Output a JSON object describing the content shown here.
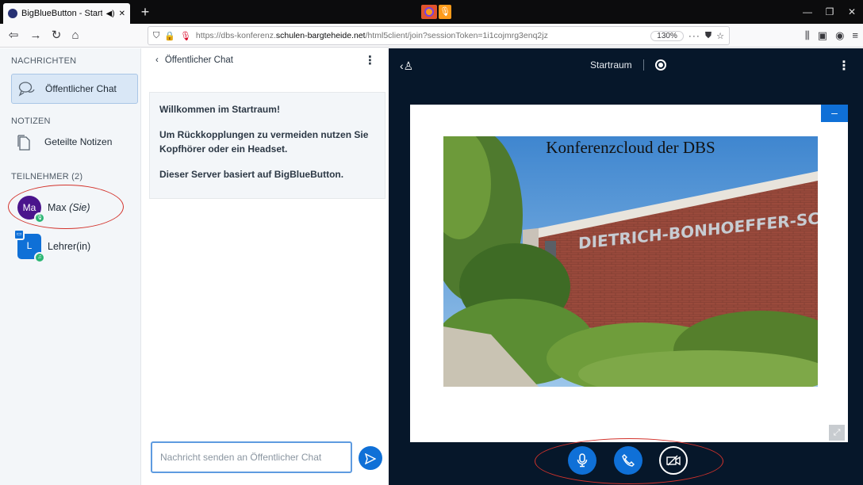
{
  "browser": {
    "tab_title": "BigBlueButton - Startraum",
    "tab_audio_icon": "speaker-icon",
    "tab_close": "✕",
    "new_tab": "+",
    "url_prefix": "https://dbs-konferenz.",
    "url_host": "schulen-bargteheide.net",
    "url_path": "/html5client/join?sessionToken=1i1cojmrg3enq2jz",
    "zoom": "130%",
    "more": "···"
  },
  "sidebar": {
    "messages_heading": "NACHRICHTEN",
    "public_chat_label": "Öffentlicher Chat",
    "notes_heading": "NOTIZEN",
    "shared_notes_label": "Geteilte Notizen",
    "participants_heading": "TEILNEHMER (2)",
    "users": [
      {
        "initials": "Ma",
        "name": "Max",
        "self_label": "(Sie)",
        "color": "#4a148c"
      },
      {
        "initials": "L",
        "name": "Lehrer(in)",
        "color": "#0f70d7"
      }
    ]
  },
  "chat": {
    "back_label": "‹",
    "title": "Öffentlicher Chat",
    "welcome_prefix": "Willkommen im ",
    "welcome_room": "Startraum",
    "welcome_suffix": "!",
    "welcome_line2": "Um Rückkopplungen zu vermeiden nutzen Sie Kopfhörer oder ein Headset.",
    "welcome_line3": "Dieser Server basiert auf BigBlueButton.",
    "input_placeholder": "Nachricht senden an Öffentlicher Chat"
  },
  "stage": {
    "room_name": "Startraum",
    "slide_title": "Konferenzcloud der DBS",
    "minimize_label": "–",
    "wall_lettering": "DIETRICH-BONHOEFFER-SCHULE"
  },
  "colors": {
    "primary": "#0f70d7",
    "stage_bg": "#06172a",
    "annotation_red": "#d3322b"
  }
}
